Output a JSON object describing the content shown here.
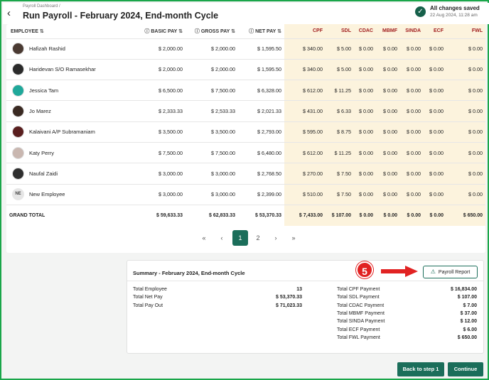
{
  "header": {
    "breadcrumb": "Payroll Dashboard /",
    "title": "Run Payroll - February 2024, End-month Cycle",
    "save_status": "All changes saved",
    "save_time": "22 Aug 2024, 11:28 am"
  },
  "table": {
    "columns": {
      "employee": "EMPLOYEE",
      "basic_pay": "BASIC PAY",
      "gross_pay": "GROSS PAY",
      "net_pay": "NET PAY",
      "cpf": "CPF",
      "sdl": "SDL",
      "cdac": "CDAC",
      "mbmf": "MBMF",
      "sinda": "SINDA",
      "ecf": "ECF",
      "fwl": "FWL"
    },
    "rows": [
      {
        "name": "Hafizah Rashid",
        "basic": "$ 2,000.00",
        "gross": "$ 2,000.00",
        "net": "$ 1,595.50",
        "cpf": "$ 340.00",
        "sdl": "$ 5.00",
        "cdac": "$ 0.00",
        "mbmf": "$ 0.00",
        "sinda": "$ 0.00",
        "ecf": "$ 0.00",
        "fwl": "$ 0.00",
        "avatar_color": "#4a3a32"
      },
      {
        "name": "Haridevan S/O Ramasekhar",
        "basic": "$ 2,000.00",
        "gross": "$ 2,000.00",
        "net": "$ 1,595.50",
        "cpf": "$ 340.00",
        "sdl": "$ 5.00",
        "cdac": "$ 0.00",
        "mbmf": "$ 0.00",
        "sinda": "$ 0.00",
        "ecf": "$ 0.00",
        "fwl": "$ 0.00",
        "avatar_color": "#2b2b2b"
      },
      {
        "name": "Jessica Tam",
        "basic": "$ 6,500.00",
        "gross": "$ 7,500.00",
        "net": "$ 6,328.00",
        "cpf": "$ 612.00",
        "sdl": "$ 11.25",
        "cdac": "$ 0.00",
        "mbmf": "$ 0.00",
        "sinda": "$ 0.00",
        "ecf": "$ 0.00",
        "fwl": "$ 0.00",
        "avatar_color": "#1fa89a"
      },
      {
        "name": "Jo Marez",
        "basic": "$ 2,333.33",
        "gross": "$ 2,533.33",
        "net": "$ 2,021.33",
        "cpf": "$ 431.00",
        "sdl": "$ 6.33",
        "cdac": "$ 0.00",
        "mbmf": "$ 0.00",
        "sinda": "$ 0.00",
        "ecf": "$ 0.00",
        "fwl": "$ 0.00",
        "avatar_color": "#3a2a22"
      },
      {
        "name": "Kalaivani A/P Subramaniam",
        "basic": "$ 3,500.00",
        "gross": "$ 3,500.00",
        "net": "$ 2,793.00",
        "cpf": "$ 595.00",
        "sdl": "$ 8.75",
        "cdac": "$ 0.00",
        "mbmf": "$ 0.00",
        "sinda": "$ 0.00",
        "ecf": "$ 0.00",
        "fwl": "$ 0.00",
        "avatar_color": "#5a1f1f"
      },
      {
        "name": "Katy Perry",
        "basic": "$ 7,500.00",
        "gross": "$ 7,500.00",
        "net": "$ 6,480.00",
        "cpf": "$ 612.00",
        "sdl": "$ 11.25",
        "cdac": "$ 0.00",
        "mbmf": "$ 0.00",
        "sinda": "$ 0.00",
        "ecf": "$ 0.00",
        "fwl": "$ 0.00",
        "avatar_color": "#c9b7b0"
      },
      {
        "name": "Naufal Zaidi",
        "basic": "$ 3,000.00",
        "gross": "$ 3,000.00",
        "net": "$ 2,768.50",
        "cpf": "$ 270.00",
        "sdl": "$ 7.50",
        "cdac": "$ 0.00",
        "mbmf": "$ 0.00",
        "sinda": "$ 0.00",
        "ecf": "$ 0.00",
        "fwl": "$ 0.00",
        "avatar_color": "#2f2f2f"
      },
      {
        "name": "New Employee",
        "initials": "NE",
        "basic": "$ 3,000.00",
        "gross": "$ 3,000.00",
        "net": "$ 2,399.00",
        "cpf": "$ 510.00",
        "sdl": "$ 7.50",
        "cdac": "$ 0.00",
        "mbmf": "$ 0.00",
        "sinda": "$ 0.00",
        "ecf": "$ 0.00",
        "fwl": "$ 0.00",
        "avatar_color": "#e6e6e6"
      }
    ],
    "total": {
      "label": "GRAND TOTAL",
      "basic": "$ 59,633.33",
      "gross": "$ 62,833.33",
      "net": "$ 53,370.33",
      "cpf": "$ 7,433.00",
      "sdl": "$ 107.00",
      "cdac": "$ 0.00",
      "mbmf": "$ 0.00",
      "sinda": "$ 0.00",
      "ecf": "$ 0.00",
      "fwl": "$ 650.00"
    }
  },
  "pagination": {
    "first": "«",
    "prev": "‹",
    "page1": "1",
    "page2": "2",
    "next": "›",
    "last": "»"
  },
  "summary": {
    "title": "Summary - February 2024, End-month Cycle",
    "step_badge": "5",
    "report_button": "Payroll Report",
    "left": [
      {
        "label": "Total Employee",
        "value": "13"
      },
      {
        "label": "Total Net Pay",
        "value": "$ 53,370.33"
      },
      {
        "label": "Total Pay Out",
        "value": "$ 71,023.33"
      }
    ],
    "right": [
      {
        "label": "Total CPF Payment",
        "value": "$ 16,834.00"
      },
      {
        "label": "Total SDL Payment",
        "value": "$ 107.00"
      },
      {
        "label": "Total CDAC Payment",
        "value": "$ 7.00"
      },
      {
        "label": "Total MBMF Payment",
        "value": "$ 37.00"
      },
      {
        "label": "Total SINDA Payment",
        "value": "$ 12.00"
      },
      {
        "label": "Total ECF Payment",
        "value": "$ 6.00"
      },
      {
        "label": "Total FWL Payment",
        "value": "$ 650.00"
      }
    ]
  },
  "footer": {
    "back_label": "Back to step 1",
    "continue_label": "Continue"
  },
  "colors": {
    "brand_green": "#1b6e5a",
    "highlight_border": "#1aa64a",
    "tax_column_bg": "#fcf3dd",
    "annotation_red": "#e12222"
  }
}
